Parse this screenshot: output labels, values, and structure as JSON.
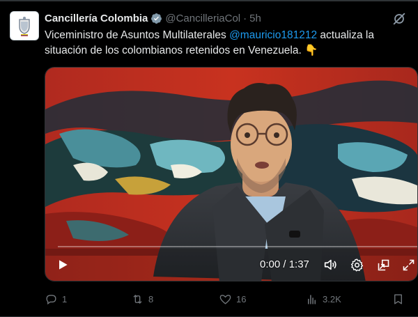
{
  "author": {
    "display_name": "Cancillería Colombia",
    "handle": "@CancilleriaCol",
    "separator": "·",
    "time": "5h"
  },
  "tweet": {
    "text_before": "Viceministro de Asuntos Multilaterales ",
    "mention": "@mauricio181212",
    "text_after": " actualiza la situación de los colombianos retenidos en Venezuela.",
    "emoji": "👇"
  },
  "video": {
    "timecode": "0:00 / 1:37",
    "progress": 0.0
  },
  "actions": {
    "replies": "1",
    "reposts": "8",
    "likes": "16",
    "views": "3.2K"
  },
  "colors": {
    "accent": "#1d9bf0",
    "verified": "#829aab",
    "muted": "#71767b"
  }
}
